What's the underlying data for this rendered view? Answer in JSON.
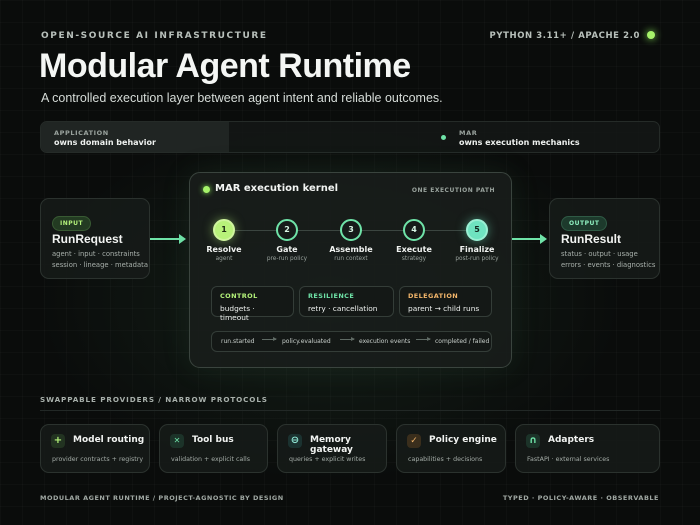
{
  "header": {
    "eyebrow": "OPEN-SOURCE AI INFRASTRUCTURE",
    "meta": "PYTHON 3.11+ / APACHE 2.0",
    "title": "Modular Agent Runtime",
    "subtitle": "A controlled execution layer between agent intent and reliable outcomes."
  },
  "ownership": {
    "left_label": "APPLICATION",
    "left_value": "owns domain behavior",
    "right_label": "MAR",
    "right_value": "owns execution mechanics"
  },
  "input": {
    "badge": "INPUT",
    "title": "RunRequest",
    "lines": [
      "agent · input · constraints",
      "session · lineage · metadata"
    ]
  },
  "output": {
    "badge": "OUTPUT",
    "title": "RunResult",
    "lines": [
      "status · output · usage",
      "errors · events · diagnostics"
    ]
  },
  "kernel": {
    "title": "MAR execution kernel",
    "tag": "ONE EXECUTION PATH",
    "steps": [
      {
        "num": "1",
        "name": "Resolve",
        "sub": "agent"
      },
      {
        "num": "2",
        "name": "Gate",
        "sub": "pre-run policy"
      },
      {
        "num": "3",
        "name": "Assemble",
        "sub": "run context"
      },
      {
        "num": "4",
        "name": "Execute",
        "sub": "strategy"
      },
      {
        "num": "5",
        "name": "Finalize",
        "sub": "post-run policy"
      }
    ],
    "panels": [
      {
        "title": "CONTROL",
        "value": "budgets · timeout",
        "color": "#b4f27a"
      },
      {
        "title": "RESILIENCE",
        "value": "retry · cancellation",
        "color": "#6fe3a8"
      },
      {
        "title": "DELEGATION",
        "value": "parent → child runs",
        "color": "#f2b56a"
      }
    ],
    "events": [
      "run.started",
      "policy.evaluated",
      "execution events",
      "completed / failed"
    ]
  },
  "providers": {
    "section_label": "SWAPPABLE PROVIDERS / NARROW PROTOCOLS",
    "items": [
      {
        "title": "Model routing",
        "sub": "provider contracts + registry",
        "icon": "plus-icon",
        "glyph": "+",
        "color": "#b4f27a"
      },
      {
        "title": "Tool bus",
        "sub": "validation + explicit calls",
        "icon": "cross-tools-icon",
        "glyph": "✕",
        "color": "#6fe3a8"
      },
      {
        "title": "Memory gateway",
        "sub": "queries + explicit writes",
        "icon": "database-icon",
        "glyph": "⊖",
        "color": "#8fe6d4"
      },
      {
        "title": "Policy engine",
        "sub": "capabilities + decisions",
        "icon": "check-icon",
        "glyph": "✓",
        "color": "#f2b56a"
      },
      {
        "title": "Adapters",
        "sub": "FastAPI · external services",
        "icon": "arch-icon",
        "glyph": "∩",
        "color": "#6fe3a8"
      }
    ]
  },
  "footer": {
    "left": "MODULAR AGENT RUNTIME / PROJECT-AGNOSTIC BY DESIGN",
    "right": "TYPED · POLICY-AWARE · OBSERVABLE"
  },
  "colors": {
    "accent_lime": "#a6f36a",
    "accent_mint": "#6fe3a8",
    "accent_orange": "#f2b56a",
    "background": "#0a0c0b"
  }
}
